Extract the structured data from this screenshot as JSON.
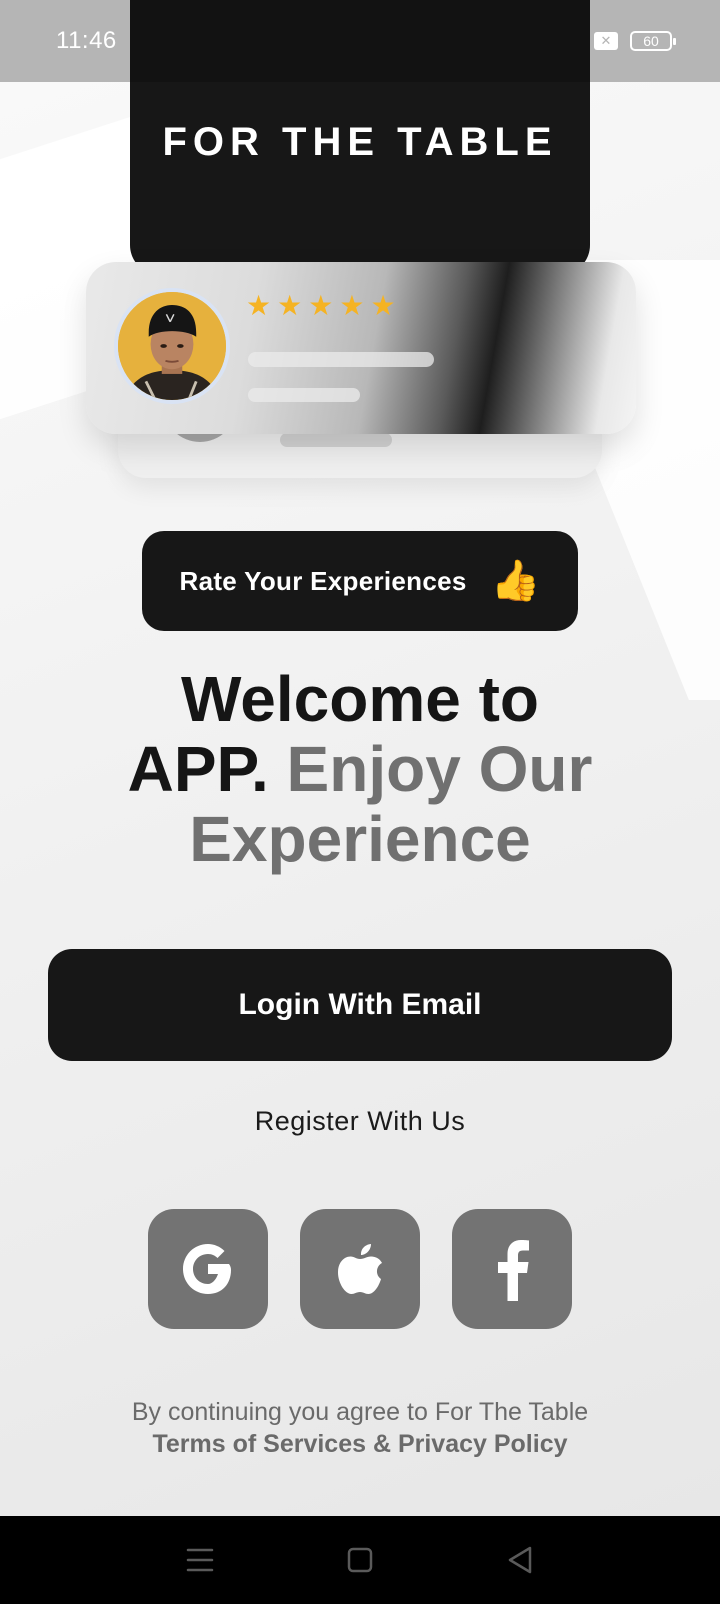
{
  "status_bar": {
    "time": "11:46",
    "battery": "60",
    "sim_symbol": "✕"
  },
  "header": {
    "brand": "FOR THE TABLE"
  },
  "review_card": {
    "rating": 5,
    "star_color": "#f5b323"
  },
  "rate_pill": {
    "label": "Rate Your Experiences",
    "emoji": "👍"
  },
  "welcome": {
    "line1": "Welcome to",
    "line2_dark": "APP.",
    "line2_grey": "Enjoy Our",
    "line3_grey": "Experience"
  },
  "auth": {
    "login_label": "Login With Email",
    "register_label": "Register With Us"
  },
  "social": [
    {
      "name": "google",
      "icon": "google-icon"
    },
    {
      "name": "apple",
      "icon": "apple-icon"
    },
    {
      "name": "facebook",
      "icon": "facebook-icon"
    }
  ],
  "legal": {
    "line1": "By continuing you agree to For The Table",
    "line2": "Terms of Services & Privacy Policy"
  },
  "colors": {
    "primary_dark": "#171717",
    "secondary_grey": "#737373",
    "status_bar_bg": "#b5b5b5"
  }
}
